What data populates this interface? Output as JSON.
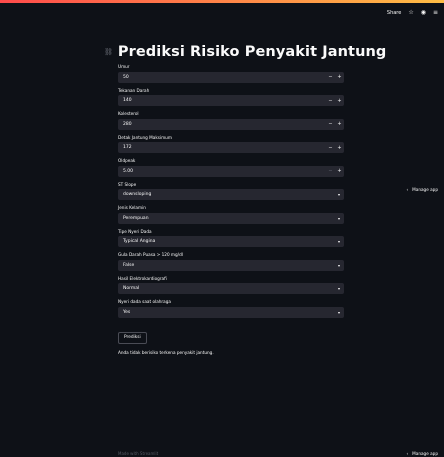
{
  "toolbar": {
    "share_label": "Share",
    "star_icon": "star-icon",
    "github_icon": "github-icon",
    "menu_icon": "menu-icon"
  },
  "header": {
    "link_icon": "link-icon",
    "title": "Prediksi Risiko Penyakit Jantung"
  },
  "fields": {
    "umur": {
      "label": "Umur",
      "value": "50"
    },
    "tekanan_darah": {
      "label": "Tekanan Darah",
      "value": "140"
    },
    "kolesterol": {
      "label": "Kolesterol",
      "value": "280"
    },
    "detak_jantung": {
      "label": "Detak Jantung Maksimum",
      "value": "172"
    },
    "oldpeak": {
      "label": "Oldpeak",
      "value": "5.00"
    },
    "st_slope": {
      "label": "ST Slope",
      "value": "downsloping"
    },
    "jenis_kelamin": {
      "label": "Jenis Kelamin",
      "value": "Perempuan"
    },
    "tipe_nyeri": {
      "label": "Tipe Nyeri Dada",
      "value": "Typical Angina"
    },
    "gula_darah": {
      "label": "Gula Darah Puasa > 120 mg/dl",
      "value": "False"
    },
    "ekg": {
      "label": "Hasil Elektrokardiografi",
      "value": "Normal"
    },
    "nyeri_olahraga": {
      "label": "Nyeri dada saat olahraga",
      "value": "Yes"
    }
  },
  "controls": {
    "minus": "−",
    "plus": "+",
    "chevron": "▾"
  },
  "predict_button": {
    "label": "Prediksi"
  },
  "result": {
    "text": "Anda tidak berisiko terkena penyakit jantung."
  },
  "manage_app": {
    "label": "Manage app",
    "icon": "chevron-left-icon"
  },
  "footer": {
    "text": "Made with Streamlit"
  },
  "colors": {
    "background": "#0e1117",
    "input": "#262730",
    "text": "#fafafa",
    "accent": "#ff4b4b"
  }
}
